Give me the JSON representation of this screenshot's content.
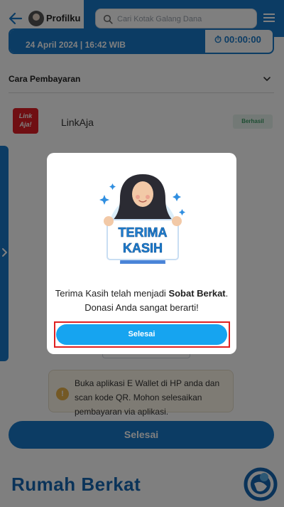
{
  "header": {
    "back_icon": "arrow-left-icon",
    "profile_label": "Profilku",
    "search_placeholder": "Cari Kotak Galang Dana",
    "menu_icon": "hamburger-menu-icon"
  },
  "donation": {
    "date_time": "24 April 2024 | 16:42 WIB",
    "timer": "00:00:00"
  },
  "payment": {
    "section_title": "Cara Pembayaran",
    "method_logo_text": "Link Aja!",
    "method_name": "LinkAja",
    "status_badge": "Berhasil"
  },
  "info": {
    "icon_text": "!",
    "text": "Buka aplikasi E Wallet di HP anda dan scan kode QR. Mohon selesaikan pembayaran via aplikasi."
  },
  "main_button_label": "Selesai",
  "footer": {
    "brand": "Rumah Berkat"
  },
  "modal": {
    "illustration_text_line1": "TERIMA",
    "illustration_text_line2": "KASIH",
    "message_prefix": "Terima Kasih telah menjadi ",
    "message_bold": "Sobat Berkat",
    "message_suffix": ". Donasi Anda sangat berarti!",
    "button_label": "Selesai"
  },
  "colors": {
    "primary": "#1879c9",
    "modal_button": "#16a4f0",
    "highlight": "#e02020",
    "success": "#3a9a64"
  }
}
